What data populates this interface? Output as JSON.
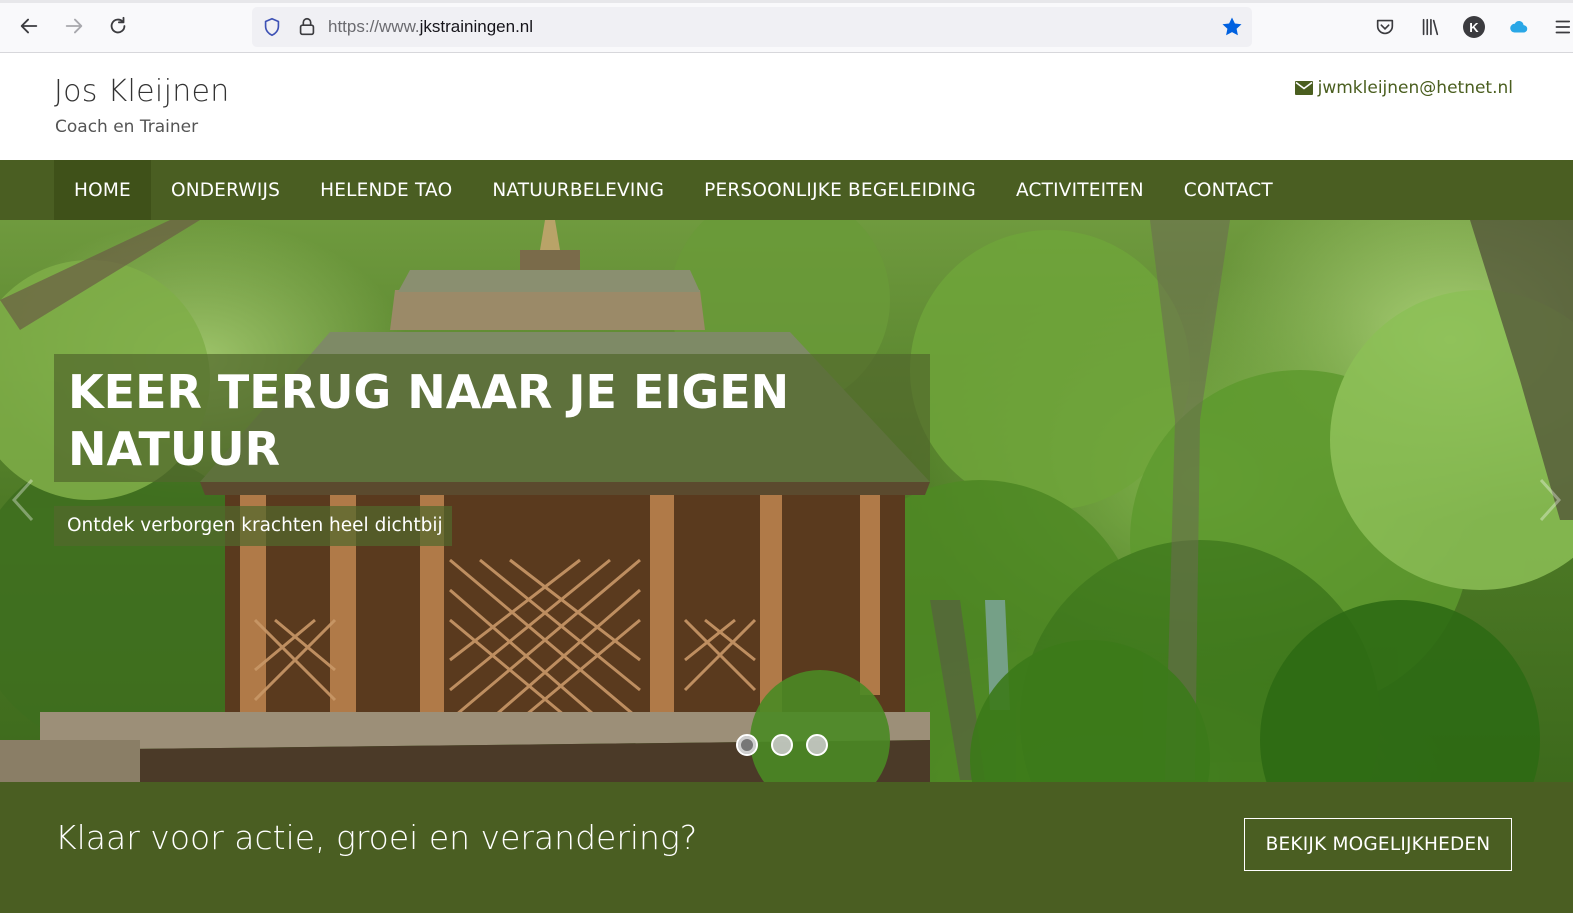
{
  "browser": {
    "url_prefix": "https://www.",
    "url_domain": "jkstrainingen.nl",
    "icons": [
      "back-arrow-icon",
      "forward-arrow-icon",
      "reload-icon",
      "shield-icon",
      "lock-icon",
      "bookmark-star-icon",
      "pocket-icon",
      "library-icon",
      "account-avatar-icon",
      "cloud-icon",
      "menu-icon"
    ],
    "avatar_letter": "K",
    "accent": "#0061e0"
  },
  "header": {
    "brand_name": "Jos Kleijnen",
    "brand_subtitle": "Coach en Trainer",
    "email": "jwmkleijnen@hetnet.nl"
  },
  "nav": {
    "items": [
      {
        "label": "HOME",
        "active": true
      },
      {
        "label": "ONDERWIJS"
      },
      {
        "label": "HELENDE TAO"
      },
      {
        "label": "NATUURBELEVING"
      },
      {
        "label": "PERSOONLIJKE BEGELEIDING"
      },
      {
        "label": "ACTIVITEITEN"
      },
      {
        "label": "CONTACT"
      }
    ]
  },
  "hero": {
    "title": "KEER TERUG NAAR JE EIGEN NATUUR",
    "subtitle": "Ontdek verborgen krachten heel dichtbij",
    "slide_count": 3,
    "active_slide": 1
  },
  "cta": {
    "text": "Klaar voor actie, groei en verandering?",
    "button_label": "BEKIJK MOGELIJKHEDEN"
  },
  "colors": {
    "brand_green": "#4a5e22",
    "nav_active": "#3f5119",
    "email_green": "#4a5e1f"
  }
}
